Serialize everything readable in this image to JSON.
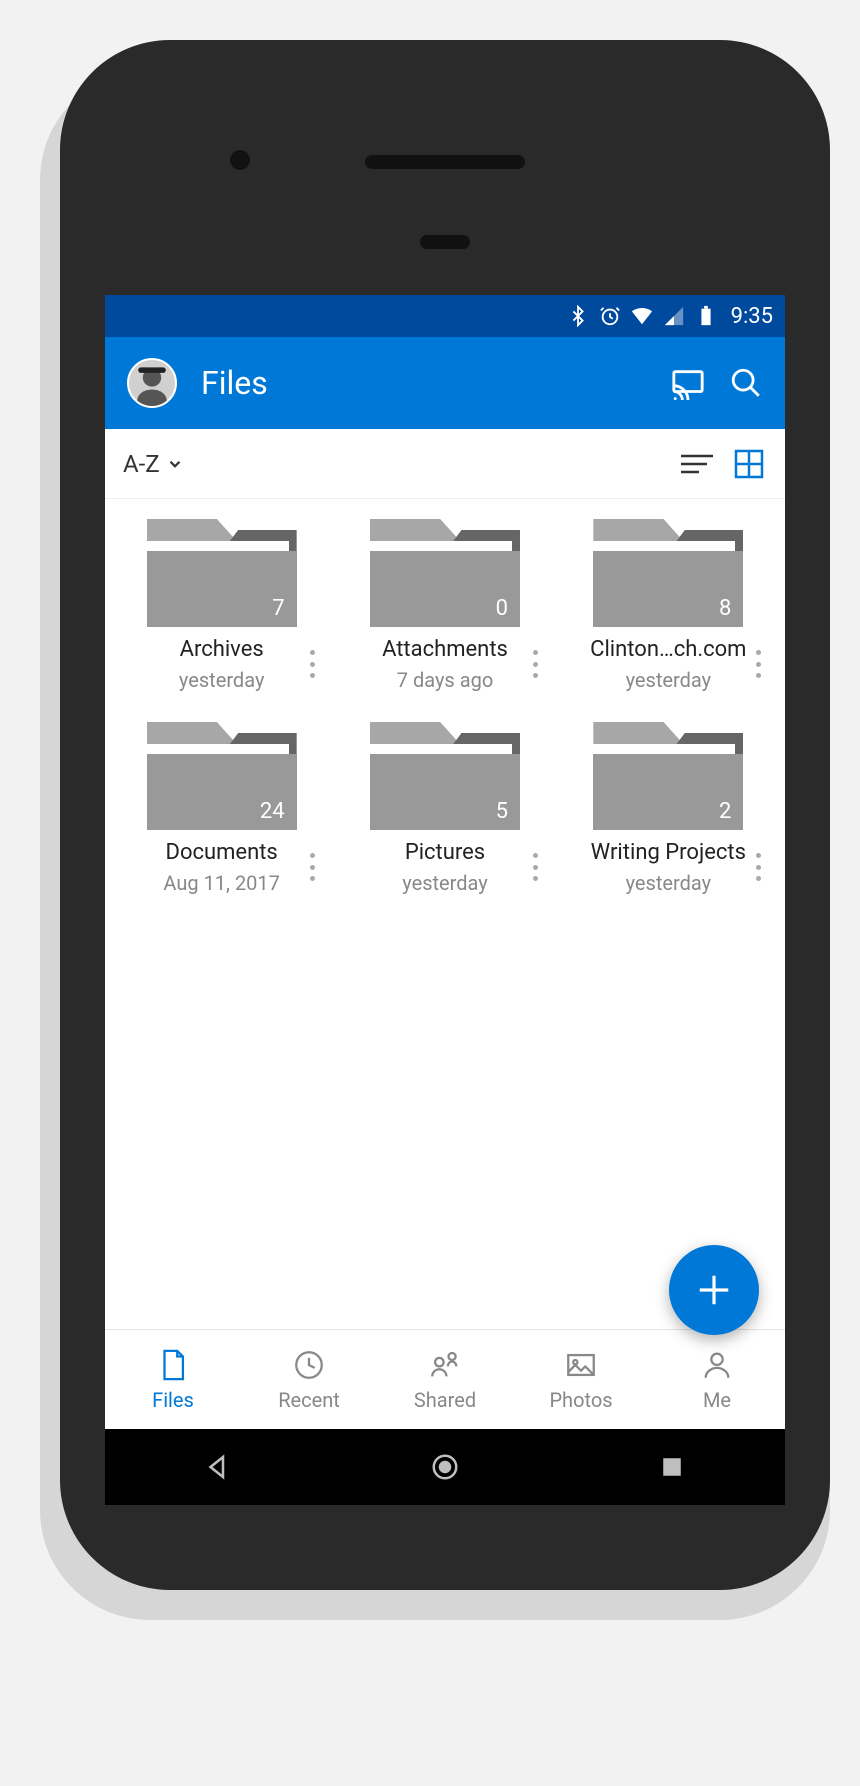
{
  "status_bar": {
    "time": "9:35"
  },
  "app_bar": {
    "title": "Files"
  },
  "toolbar": {
    "sort_label": "A-Z"
  },
  "folders": [
    {
      "name": "Archives",
      "count": "7",
      "date": "yesterday"
    },
    {
      "name": "Attachments",
      "count": "0",
      "date": "7 days ago"
    },
    {
      "name": "Clinton…ch.com",
      "count": "8",
      "date": "yesterday"
    },
    {
      "name": "Documents",
      "count": "24",
      "date": "Aug 11, 2017"
    },
    {
      "name": "Pictures",
      "count": "5",
      "date": "yesterday"
    },
    {
      "name": "Writing Projects",
      "count": "2",
      "date": "yesterday"
    }
  ],
  "tabs": [
    {
      "label": "Files",
      "active": true
    },
    {
      "label": "Recent",
      "active": false
    },
    {
      "label": "Shared",
      "active": false
    },
    {
      "label": "Photos",
      "active": false
    },
    {
      "label": "Me",
      "active": false
    }
  ]
}
